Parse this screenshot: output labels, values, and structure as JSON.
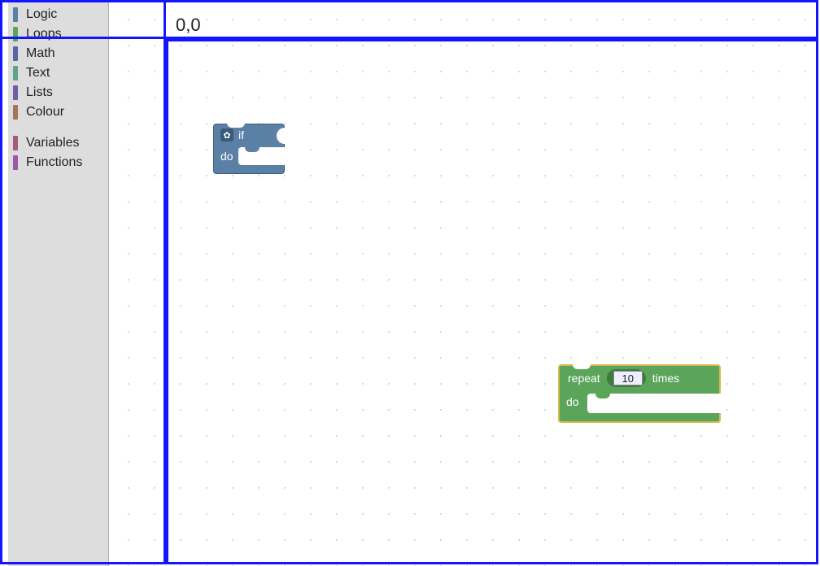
{
  "colors": {
    "overlay": "#1414ff",
    "logic": "#5b80a5",
    "loops": "#5ba55b",
    "math": "#5b67a5",
    "text": "#5ba58c",
    "lists": "#745ba5",
    "colour": "#a5745b",
    "variables": "#a55b80",
    "functions": "#995ba5",
    "select_highlight": "#d6b84a"
  },
  "overlay": {
    "origin_label": "0,0"
  },
  "toolbox": {
    "categories": [
      {
        "label": "Logic",
        "color_key": "logic"
      },
      {
        "label": "Loops",
        "color_key": "loops"
      },
      {
        "label": "Math",
        "color_key": "math"
      },
      {
        "label": "Text",
        "color_key": "text"
      },
      {
        "label": "Lists",
        "color_key": "lists"
      },
      {
        "label": "Colour",
        "color_key": "colour"
      }
    ],
    "categories2": [
      {
        "label": "Variables",
        "color_key": "variables"
      },
      {
        "label": "Functions",
        "color_key": "functions"
      }
    ]
  },
  "workspace": {
    "blocks": {
      "if_block": {
        "gear_icon": "✿",
        "if_label": "if",
        "do_label": "do"
      },
      "repeat_block": {
        "repeat_label": "repeat",
        "times_label": "times",
        "do_label": "do",
        "count_value": "10",
        "selected": true
      }
    }
  }
}
